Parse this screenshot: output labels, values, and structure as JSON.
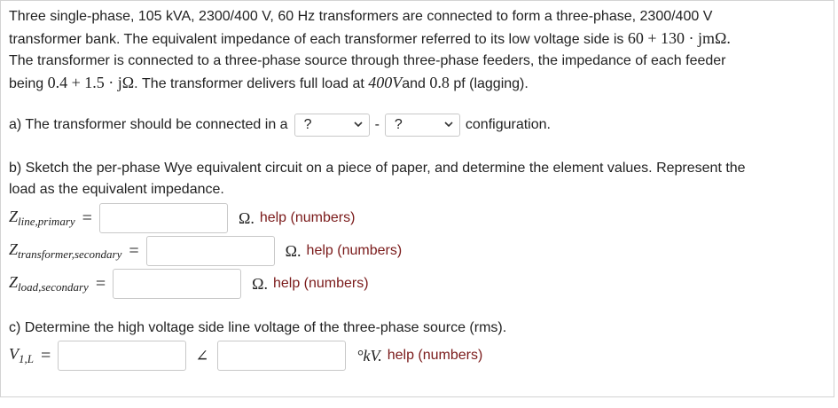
{
  "problem": {
    "line1": "Three single-phase, 105 kVA, 2300/400 V, 60 Hz transformers are connected to form a three-phase, 2300/400 V",
    "line2_a": "transformer bank. The equivalent impedance of each transformer referred to its low voltage side is ",
    "line2_math": "60 + 130 · jmΩ.",
    "line3": "The transformer is connected to a three-phase source through three-phase feeders, the impedance of each feeder",
    "line4_a": "being ",
    "line4_math1": "0.4 + 1.5 · jΩ",
    "line4_b": ". The transformer delivers full load at ",
    "line4_math2": "400V",
    "line4_c": "and ",
    "line4_math3": "0.8",
    "line4_d": " pf (lagging)."
  },
  "part_a": {
    "text": "a) The transformer should be connected in a",
    "select1_value": "?",
    "dash": "-",
    "select2_value": "?",
    "suffix": "configuration."
  },
  "part_b": {
    "line1": "b) Sketch the per-phase Wye equivalent circuit on a piece of paper, and determine the element values. Represent the",
    "line2": "load as the equivalent impedance.",
    "fields": [
      {
        "label_main": "Z",
        "label_sub": "line,primary",
        "eq": "=",
        "value": "",
        "unit": "Ω.",
        "help": "help (numbers)"
      },
      {
        "label_main": "Z",
        "label_sub": "transformer,secondary",
        "eq": "=",
        "value": "",
        "unit": "Ω.",
        "help": "help (numbers)"
      },
      {
        "label_main": "Z",
        "label_sub": "load,secondary",
        "eq": "=",
        "value": "",
        "unit": "Ω.",
        "help": "help (numbers)"
      }
    ]
  },
  "part_c": {
    "text": "c) Determine the high voltage side line voltage of the three-phase source (rms).",
    "label_main": "V",
    "label_sub": "1,L",
    "eq": "=",
    "mag_value": "",
    "angle_symbol": "∠",
    "angle_value": "",
    "unit": "°kV.",
    "help": "help (numbers)"
  }
}
